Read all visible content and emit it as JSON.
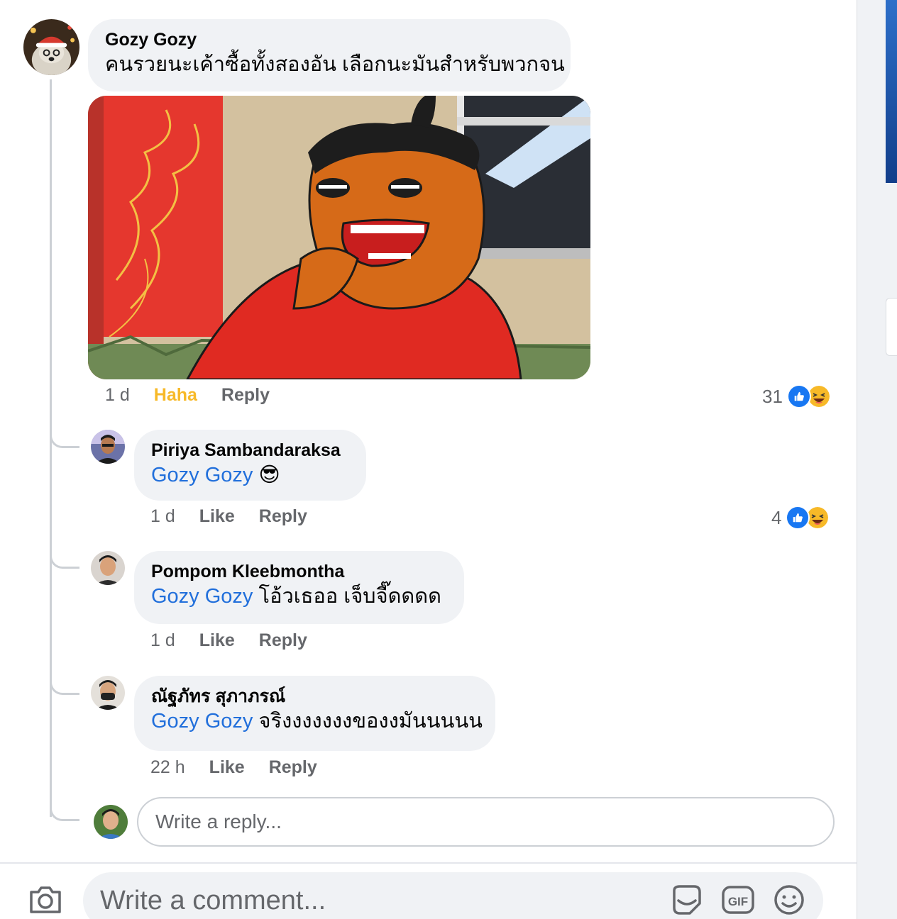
{
  "main_comment": {
    "author": "Gozy Gozy",
    "text": "คนรวยนะเค้าซื้อทั้งสองอัน เลือกนะมันสำหรับพวกจน",
    "time": "1 d",
    "reaction_label": "Haha",
    "reply_label": "Reply",
    "reaction_count": "31"
  },
  "replies": [
    {
      "author": "Piriya Sambandaraksa",
      "mention": "Gozy Gozy",
      "text": "😎",
      "time": "1 d",
      "like_label": "Like",
      "reply_label": "Reply",
      "reaction_count": "4"
    },
    {
      "author": "Pompom Kleebmontha",
      "mention": "Gozy Gozy",
      "text": "โอ้วเธออ เจ็บจี๊ดดดด",
      "time": "1 d",
      "like_label": "Like",
      "reply_label": "Reply"
    },
    {
      "author": "ณัฐภัทร สุภาภรณ์",
      "mention": "Gozy Gozy",
      "text": "จริงงงงงงงของงมันนนนน",
      "time": "22 h",
      "like_label": "Like",
      "reply_label": "Reply"
    }
  ],
  "reply_box": {
    "placeholder": "Write a reply..."
  },
  "comment_box": {
    "placeholder": "Write a comment..."
  },
  "icons": {
    "like": "like-icon",
    "haha": "haha-emoji-icon",
    "camera": "camera-icon",
    "sticker": "sticker-icon",
    "gif": "gif-icon",
    "emoji": "emoji-icon"
  },
  "colors": {
    "mention": "#216fdb",
    "haha": "#f7b928",
    "like": "#1877f2"
  }
}
